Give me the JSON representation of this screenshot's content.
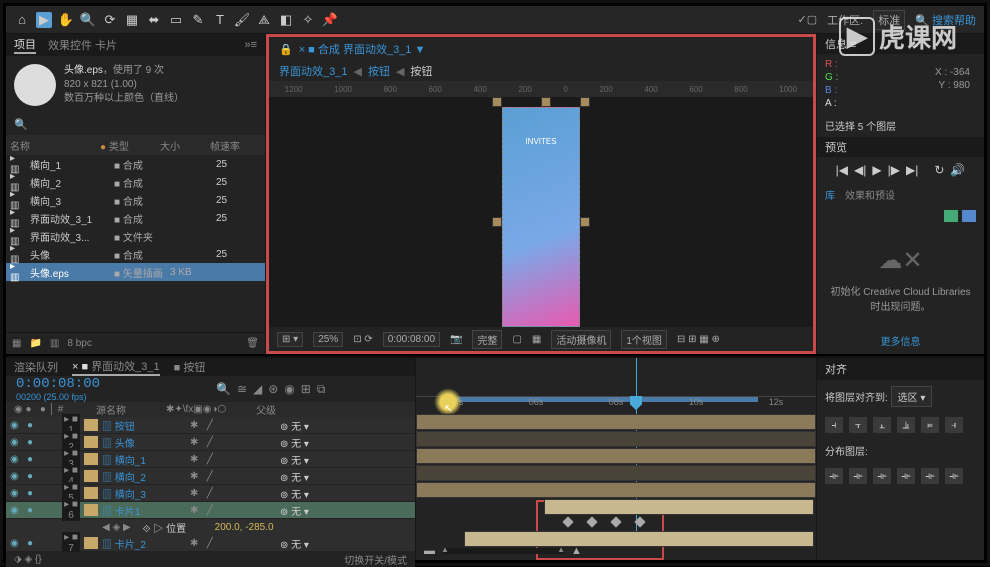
{
  "toolbar": {
    "workspace_label": "工作区:",
    "workspace_value": "标准",
    "search_help": "搜索帮助"
  },
  "project": {
    "tab_project": "项目",
    "tab_effects": "效果控件 卡片",
    "asset_name": "头像.eps",
    "asset_used": "，使用了 9 次",
    "asset_dims": "820 x 821 (1.00)",
    "asset_colors": "数百万种以上颜色（直线）",
    "col_name": "名称",
    "col_type": "类型",
    "col_size": "大小",
    "col_fps": "帧速率",
    "rows": [
      {
        "name": "横向_1",
        "type": "合成",
        "fps": "25"
      },
      {
        "name": "横向_2",
        "type": "合成",
        "fps": "25"
      },
      {
        "name": "横向_3",
        "type": "合成",
        "fps": "25"
      },
      {
        "name": "界面动效_3_1",
        "type": "合成",
        "fps": "25"
      },
      {
        "name": "界面动效_3...",
        "type": "文件夹",
        "fps": ""
      },
      {
        "name": "头像",
        "type": "合成",
        "fps": "25"
      },
      {
        "name": "头像.eps",
        "type": "矢量插画",
        "fps": "",
        "size": "3 KB",
        "sel": true
      }
    ],
    "bpc": "8 bpc"
  },
  "viewer": {
    "tab_comp": "合成",
    "comp_name": "界面动效_3_1",
    "crumb1": "界面动效_3_1",
    "crumb2": "按钮",
    "crumb3": "按钮",
    "ruler_marks": [
      "1200",
      "1000",
      "800",
      "600",
      "400",
      "200",
      "0",
      "200",
      "400",
      "600",
      "800",
      "1000"
    ],
    "screen_text": "INVITES",
    "zoom": "25%",
    "timecode": "0:00:08:00",
    "res": "完整",
    "camera": "活动摄像机",
    "views": "1个视图"
  },
  "info": {
    "r": "R :",
    "g": "G :",
    "b": "B :",
    "a": "A :",
    "x": "X : -364",
    "y": "Y : 980",
    "selection": "已选择 5 个图层"
  },
  "preview": {
    "title": "预览"
  },
  "lib": {
    "tab_lib": "库",
    "tab_fx": "效果和预设",
    "cc_msg": "初始化 Creative Cloud Libraries 时出现问题。",
    "cc_link": "更多信息"
  },
  "timeline": {
    "tab_rq": "渲染队列",
    "tab_comp": "界面动效_3_1",
    "tab_btn": "按钮",
    "timecode": "0:00:08:00",
    "frames": "00200 (25.00 fps)",
    "col_src": "源名称",
    "col_parent": "父级",
    "layers": [
      {
        "num": "1",
        "name": "按钮",
        "color": "#c8a868",
        "parent": "无"
      },
      {
        "num": "2",
        "name": "头像",
        "color": "#c8a868",
        "parent": "无"
      },
      {
        "num": "3",
        "name": "横向_1",
        "color": "#c8a868",
        "parent": "无"
      },
      {
        "num": "4",
        "name": "横向_2",
        "color": "#c8a868",
        "parent": "无"
      },
      {
        "num": "5",
        "name": "横向_3",
        "color": "#c8a868",
        "parent": "无"
      },
      {
        "num": "6",
        "name": "卡片1",
        "color": "#c8a868",
        "parent": "无",
        "sel": true
      },
      {
        "num": "7",
        "name": "卡片_2",
        "color": "#c8a868",
        "parent": "无"
      }
    ],
    "pos_prop": "位置",
    "pos_val": "200.0, -285.0",
    "switch_modes": "切换开关/模式",
    "ruler": [
      "04s",
      "06s",
      "08s",
      "10s",
      "12s"
    ]
  },
  "align": {
    "title": "对齐",
    "label": "将图层对齐到:",
    "value": "选区",
    "dist": "分布图层:"
  },
  "watermark": "虎课网"
}
